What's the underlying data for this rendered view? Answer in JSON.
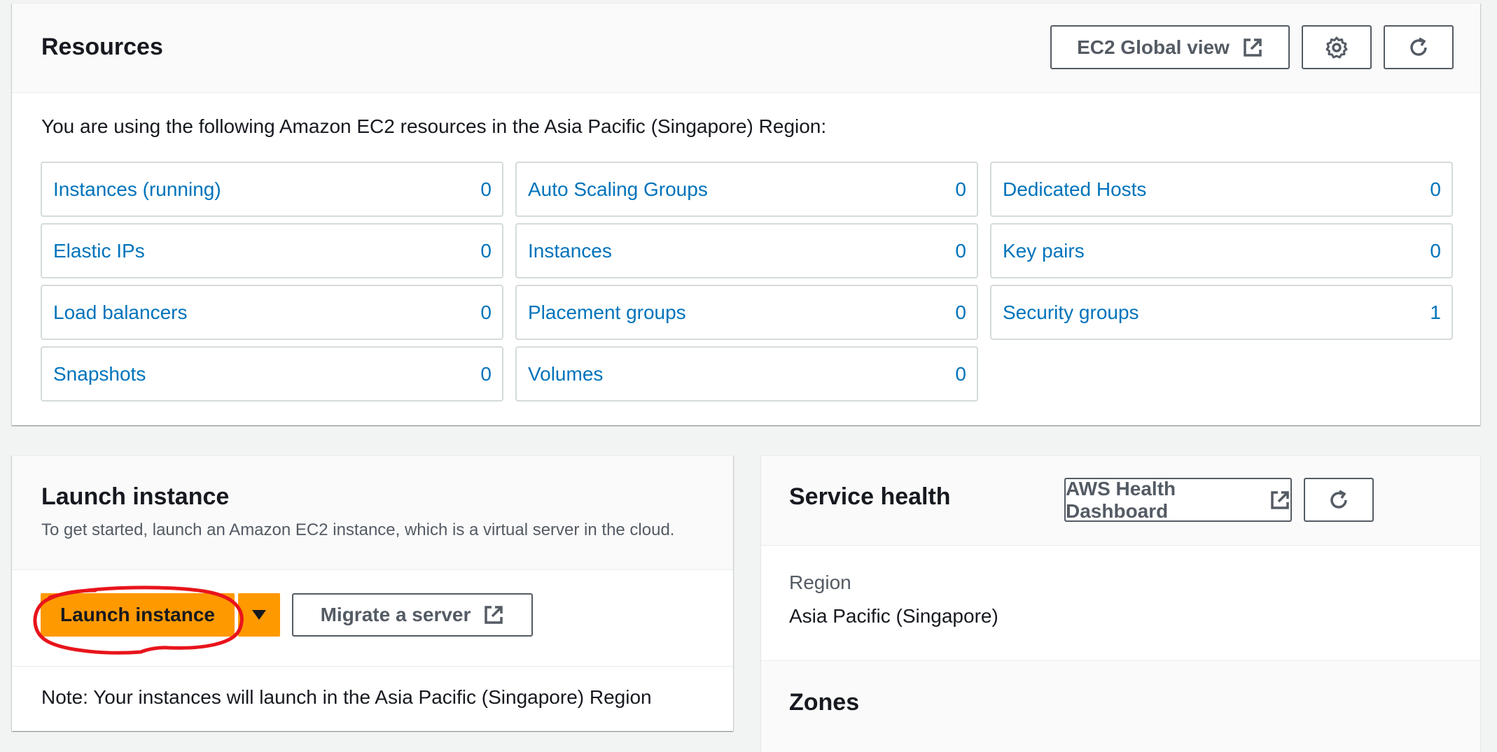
{
  "resources": {
    "title": "Resources",
    "global_view_label": "EC2 Global view",
    "intro": "You are using the following Amazon EC2 resources in the Asia Pacific (Singapore) Region:",
    "items": [
      {
        "label": "Instances (running)",
        "count": "0"
      },
      {
        "label": "Auto Scaling Groups",
        "count": "0"
      },
      {
        "label": "Dedicated Hosts",
        "count": "0"
      },
      {
        "label": "Elastic IPs",
        "count": "0"
      },
      {
        "label": "Instances",
        "count": "0"
      },
      {
        "label": "Key pairs",
        "count": "0"
      },
      {
        "label": "Load balancers",
        "count": "0"
      },
      {
        "label": "Placement groups",
        "count": "0"
      },
      {
        "label": "Security groups",
        "count": "1"
      },
      {
        "label": "Snapshots",
        "count": "0"
      },
      {
        "label": "Volumes",
        "count": "0"
      }
    ]
  },
  "launch": {
    "title": "Launch instance",
    "subtitle": "To get started, launch an Amazon EC2 instance, which is a virtual server in the cloud.",
    "launch_button": "Launch instance",
    "migrate_button": "Migrate a server",
    "note": "Note: Your instances will launch in the Asia Pacific (Singapore) Region"
  },
  "health": {
    "title": "Service health",
    "dashboard_button": "AWS Health Dashboard",
    "region_label": "Region",
    "region_value": "Asia Pacific (Singapore)",
    "zones_title": "Zones"
  },
  "colors": {
    "link": "#0073bb",
    "primary": "#ff9900",
    "annotation": "#e8141b"
  }
}
